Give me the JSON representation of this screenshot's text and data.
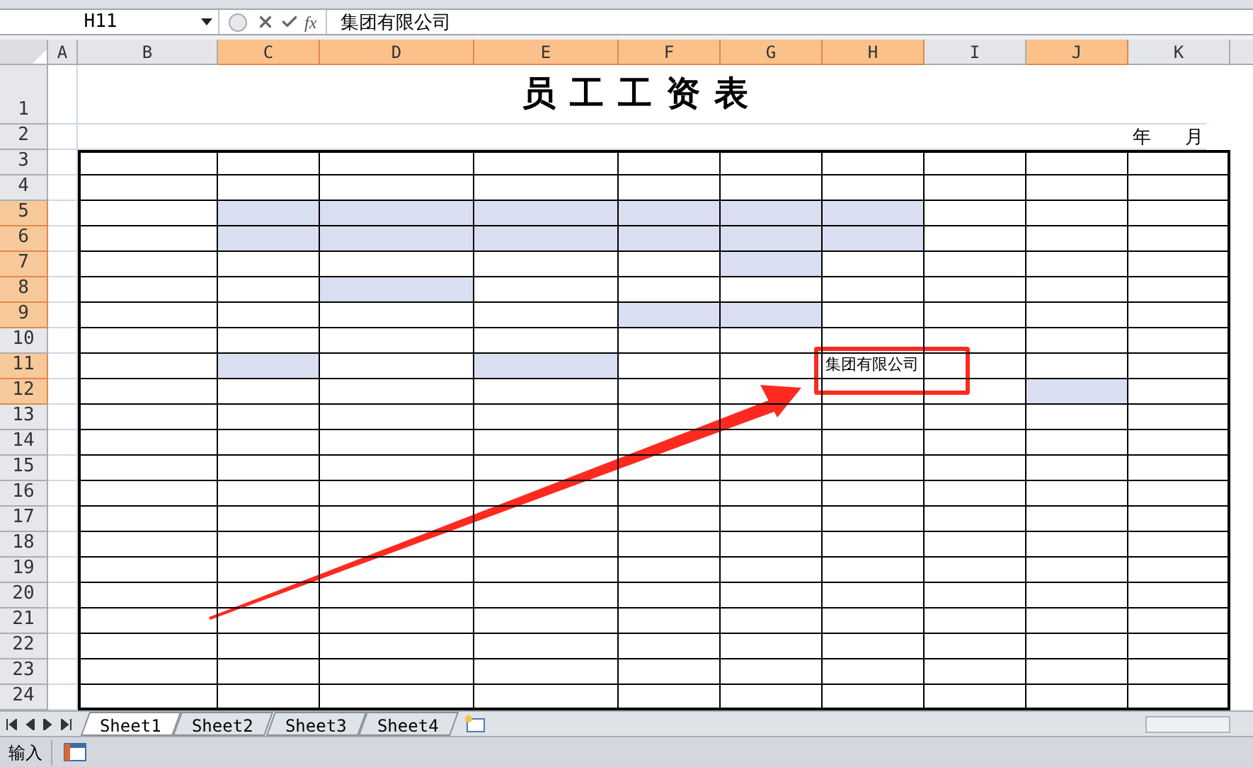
{
  "formula_bar": {
    "name_box": "H11",
    "function_label": "fx",
    "value": "集团有限公司"
  },
  "columns": [
    {
      "label": "A",
      "selected": false
    },
    {
      "label": "B",
      "selected": false
    },
    {
      "label": "C",
      "selected": true
    },
    {
      "label": "D",
      "selected": true
    },
    {
      "label": "E",
      "selected": true
    },
    {
      "label": "F",
      "selected": true
    },
    {
      "label": "G",
      "selected": true
    },
    {
      "label": "H",
      "selected": true
    },
    {
      "label": "I",
      "selected": false
    },
    {
      "label": "J",
      "selected": true
    },
    {
      "label": "K",
      "selected": false
    }
  ],
  "title_row": {
    "label": "1",
    "selected": false,
    "title": "员工工资表"
  },
  "date_row": {
    "label": "2",
    "selected": false,
    "year": "年",
    "month": "月"
  },
  "rows": [
    {
      "label": "3",
      "selected": false,
      "cells": [
        {
          "selected": false
        },
        {
          "selected": false
        },
        {
          "selected": false
        },
        {
          "selected": false
        },
        {
          "selected": false
        },
        {
          "selected": false
        },
        {
          "selected": false
        },
        {
          "selected": false
        },
        {
          "selected": false
        },
        {
          "selected": false
        }
      ]
    },
    {
      "label": "4",
      "selected": false,
      "cells": [
        {
          "selected": false
        },
        {
          "selected": false
        },
        {
          "selected": false
        },
        {
          "selected": false
        },
        {
          "selected": false
        },
        {
          "selected": false
        },
        {
          "selected": false
        },
        {
          "selected": false
        },
        {
          "selected": false
        },
        {
          "selected": false
        }
      ]
    },
    {
      "label": "5",
      "selected": true,
      "cells": [
        {
          "selected": false
        },
        {
          "selected": true
        },
        {
          "selected": true
        },
        {
          "selected": true
        },
        {
          "selected": true
        },
        {
          "selected": true
        },
        {
          "selected": true
        },
        {
          "selected": false
        },
        {
          "selected": false
        },
        {
          "selected": false
        }
      ]
    },
    {
      "label": "6",
      "selected": true,
      "cells": [
        {
          "selected": false
        },
        {
          "selected": true
        },
        {
          "selected": true
        },
        {
          "selected": true
        },
        {
          "selected": true
        },
        {
          "selected": true
        },
        {
          "selected": true
        },
        {
          "selected": false
        },
        {
          "selected": false
        },
        {
          "selected": false
        }
      ]
    },
    {
      "label": "7",
      "selected": true,
      "cells": [
        {
          "selected": false
        },
        {
          "selected": false
        },
        {
          "selected": false
        },
        {
          "selected": false
        },
        {
          "selected": false
        },
        {
          "selected": true
        },
        {
          "selected": false
        },
        {
          "selected": false
        },
        {
          "selected": false
        },
        {
          "selected": false
        }
      ]
    },
    {
      "label": "8",
      "selected": true,
      "cells": [
        {
          "selected": false
        },
        {
          "selected": false
        },
        {
          "selected": true
        },
        {
          "selected": false
        },
        {
          "selected": false
        },
        {
          "selected": false
        },
        {
          "selected": false
        },
        {
          "selected": false
        },
        {
          "selected": false
        },
        {
          "selected": false
        }
      ]
    },
    {
      "label": "9",
      "selected": true,
      "cells": [
        {
          "selected": false
        },
        {
          "selected": false
        },
        {
          "selected": false
        },
        {
          "selected": false
        },
        {
          "selected": true
        },
        {
          "selected": true
        },
        {
          "selected": false
        },
        {
          "selected": false
        },
        {
          "selected": false
        },
        {
          "selected": false
        }
      ]
    },
    {
      "label": "10",
      "selected": false,
      "cells": [
        {
          "selected": false
        },
        {
          "selected": false
        },
        {
          "selected": false
        },
        {
          "selected": false
        },
        {
          "selected": false
        },
        {
          "selected": false
        },
        {
          "selected": false
        },
        {
          "selected": false
        },
        {
          "selected": false
        },
        {
          "selected": false
        }
      ]
    },
    {
      "label": "11",
      "selected": true,
      "cells": [
        {
          "selected": false
        },
        {
          "selected": true
        },
        {
          "selected": false
        },
        {
          "selected": true
        },
        {
          "selected": false
        },
        {
          "selected": false
        },
        {
          "selected": false,
          "text": "集团有限公司"
        },
        {
          "selected": false
        },
        {
          "selected": false
        },
        {
          "selected": false
        }
      ]
    },
    {
      "label": "12",
      "selected": true,
      "cells": [
        {
          "selected": false
        },
        {
          "selected": false
        },
        {
          "selected": false
        },
        {
          "selected": false
        },
        {
          "selected": false
        },
        {
          "selected": false
        },
        {
          "selected": false
        },
        {
          "selected": false
        },
        {
          "selected": true
        },
        {
          "selected": false
        }
      ]
    },
    {
      "label": "13",
      "selected": false,
      "cells": [
        {
          "selected": false
        },
        {
          "selected": false
        },
        {
          "selected": false
        },
        {
          "selected": false
        },
        {
          "selected": false
        },
        {
          "selected": false
        },
        {
          "selected": false
        },
        {
          "selected": false
        },
        {
          "selected": false
        },
        {
          "selected": false
        }
      ]
    },
    {
      "label": "14",
      "selected": false,
      "cells": [
        {
          "selected": false
        },
        {
          "selected": false
        },
        {
          "selected": false
        },
        {
          "selected": false
        },
        {
          "selected": false
        },
        {
          "selected": false
        },
        {
          "selected": false
        },
        {
          "selected": false
        },
        {
          "selected": false
        },
        {
          "selected": false
        }
      ]
    },
    {
      "label": "15",
      "selected": false,
      "cells": [
        {
          "selected": false
        },
        {
          "selected": false
        },
        {
          "selected": false
        },
        {
          "selected": false
        },
        {
          "selected": false
        },
        {
          "selected": false
        },
        {
          "selected": false
        },
        {
          "selected": false
        },
        {
          "selected": false
        },
        {
          "selected": false
        }
      ]
    },
    {
      "label": "16",
      "selected": false,
      "cells": [
        {
          "selected": false
        },
        {
          "selected": false
        },
        {
          "selected": false
        },
        {
          "selected": false
        },
        {
          "selected": false
        },
        {
          "selected": false
        },
        {
          "selected": false
        },
        {
          "selected": false
        },
        {
          "selected": false
        },
        {
          "selected": false
        }
      ]
    },
    {
      "label": "17",
      "selected": false,
      "cells": [
        {
          "selected": false
        },
        {
          "selected": false
        },
        {
          "selected": false
        },
        {
          "selected": false
        },
        {
          "selected": false
        },
        {
          "selected": false
        },
        {
          "selected": false
        },
        {
          "selected": false
        },
        {
          "selected": false
        },
        {
          "selected": false
        }
      ]
    },
    {
      "label": "18",
      "selected": false,
      "cells": [
        {
          "selected": false
        },
        {
          "selected": false
        },
        {
          "selected": false
        },
        {
          "selected": false
        },
        {
          "selected": false
        },
        {
          "selected": false
        },
        {
          "selected": false
        },
        {
          "selected": false
        },
        {
          "selected": false
        },
        {
          "selected": false
        }
      ]
    },
    {
      "label": "19",
      "selected": false,
      "cells": [
        {
          "selected": false
        },
        {
          "selected": false
        },
        {
          "selected": false
        },
        {
          "selected": false
        },
        {
          "selected": false
        },
        {
          "selected": false
        },
        {
          "selected": false
        },
        {
          "selected": false
        },
        {
          "selected": false
        },
        {
          "selected": false
        }
      ]
    },
    {
      "label": "20",
      "selected": false,
      "cells": [
        {
          "selected": false
        },
        {
          "selected": false
        },
        {
          "selected": false
        },
        {
          "selected": false
        },
        {
          "selected": false
        },
        {
          "selected": false
        },
        {
          "selected": false
        },
        {
          "selected": false
        },
        {
          "selected": false
        },
        {
          "selected": false
        }
      ]
    },
    {
      "label": "21",
      "selected": false,
      "cells": [
        {
          "selected": false
        },
        {
          "selected": false
        },
        {
          "selected": false
        },
        {
          "selected": false
        },
        {
          "selected": false
        },
        {
          "selected": false
        },
        {
          "selected": false
        },
        {
          "selected": false
        },
        {
          "selected": false
        },
        {
          "selected": false
        }
      ]
    },
    {
      "label": "22",
      "selected": false,
      "cells": [
        {
          "selected": false
        },
        {
          "selected": false
        },
        {
          "selected": false
        },
        {
          "selected": false
        },
        {
          "selected": false
        },
        {
          "selected": false
        },
        {
          "selected": false
        },
        {
          "selected": false
        },
        {
          "selected": false
        },
        {
          "selected": false
        }
      ]
    },
    {
      "label": "23",
      "selected": false,
      "cells": [
        {
          "selected": false
        },
        {
          "selected": false
        },
        {
          "selected": false
        },
        {
          "selected": false
        },
        {
          "selected": false
        },
        {
          "selected": false
        },
        {
          "selected": false
        },
        {
          "selected": false
        },
        {
          "selected": false
        },
        {
          "selected": false
        }
      ]
    },
    {
      "label": "24",
      "selected": false,
      "cells": [
        {
          "selected": false
        },
        {
          "selected": false
        },
        {
          "selected": false
        },
        {
          "selected": false
        },
        {
          "selected": false
        },
        {
          "selected": false
        },
        {
          "selected": false
        },
        {
          "selected": false
        },
        {
          "selected": false
        },
        {
          "selected": false
        }
      ]
    }
  ],
  "sheet_tabs": [
    {
      "label": "Sheet1",
      "selected": true
    },
    {
      "label": "Sheet2",
      "selected": false
    },
    {
      "label": "Sheet3",
      "selected": false
    },
    {
      "label": "Sheet4",
      "selected": false
    }
  ],
  "status_bar": {
    "mode": "输入"
  }
}
